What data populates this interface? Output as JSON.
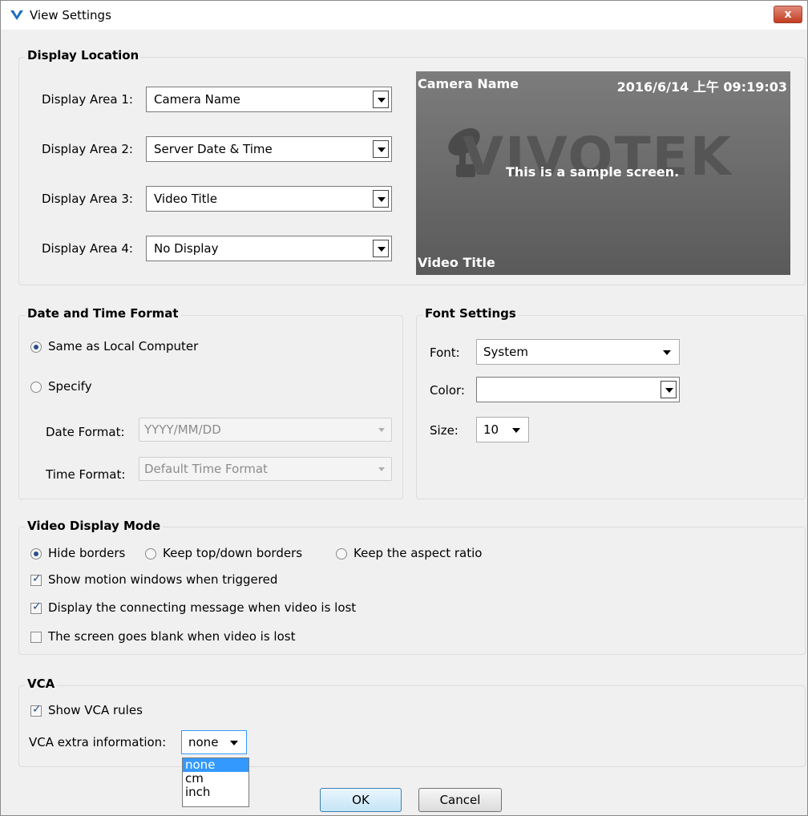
{
  "window": {
    "title": "View Settings",
    "close_glyph": "x"
  },
  "display_location": {
    "title": "Display Location",
    "areas": [
      {
        "label": "Display Area 1:",
        "value": "Camera Name"
      },
      {
        "label": "Display Area 2:",
        "value": "Server Date & Time"
      },
      {
        "label": "Display Area 3:",
        "value": "Video Title"
      },
      {
        "label": "Display Area 4:",
        "value": "No Display"
      }
    ],
    "preview": {
      "top_left": "Camera Name",
      "top_right": "2016/6/14 上午 09:19:03",
      "center": "This is a sample screen.",
      "bottom_left": "Video Title",
      "watermark": "VIVOTEK"
    }
  },
  "date_time_format": {
    "title": "Date and Time Format",
    "option_local": "Same as Local Computer",
    "option_specify": "Specify",
    "selected": "local",
    "date_label": "Date Format:",
    "date_value": "YYYY/MM/DD",
    "time_label": "Time Format:",
    "time_value": "Default Time Format"
  },
  "font_settings": {
    "title": "Font Settings",
    "font_label": "Font:",
    "font_value": "System",
    "color_label": "Color:",
    "color_value": "",
    "size_label": "Size:",
    "size_value": "10"
  },
  "video_display_mode": {
    "title": "Video Display Mode",
    "modes": [
      "Hide borders",
      "Keep top/down borders",
      "Keep the aspect ratio"
    ],
    "selected_mode": "Hide borders",
    "checks": [
      {
        "label": "Show motion windows when triggered",
        "checked": true
      },
      {
        "label": "Display the connecting message when video is lost",
        "checked": true
      },
      {
        "label": "The screen goes blank when video is lost",
        "checked": false
      }
    ]
  },
  "vca": {
    "title": "VCA",
    "show_rules_label": "Show VCA rules",
    "show_rules_checked": true,
    "extra_label": "VCA extra information:",
    "extra_value": "none",
    "extra_options": [
      "none",
      "cm",
      "inch"
    ]
  },
  "buttons": {
    "ok": "OK",
    "cancel": "Cancel"
  },
  "colors": {
    "accent": "#3399ff",
    "close": "#c43d22"
  }
}
